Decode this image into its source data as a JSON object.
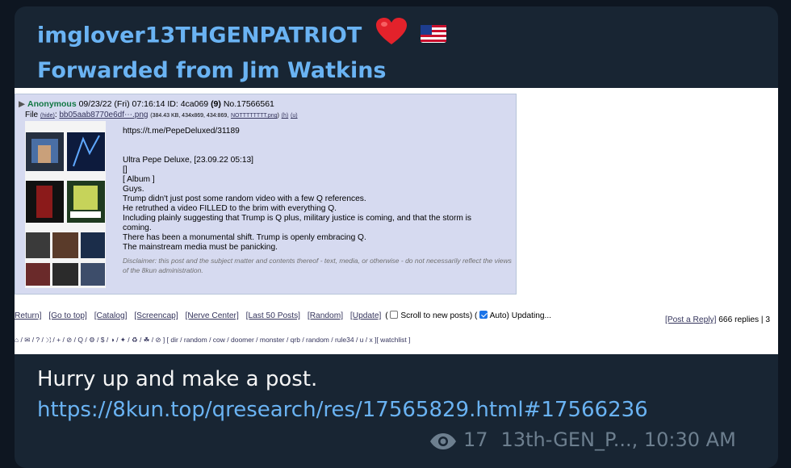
{
  "header": {
    "sender": "imglover13THGENPATRIOT",
    "forwarded": "Forwarded from Jim Watkins",
    "icons": [
      "heart-icon",
      "us-flag-icon"
    ]
  },
  "post": {
    "name": "Anonymous",
    "date": "09/23/22 (Fri) 07:16:14",
    "id_label": "ID:",
    "id": "4ca069",
    "id_count": "(9)",
    "number": "No.17566561",
    "file_label": "File",
    "hide": "(hide)",
    "filename": "bb05aab8770e6df⋯.png",
    "file_info": "(384.43 KB, 434x869, 434:869,",
    "file_orig": "NOTTTTTTTT.png",
    "file_tail": ")",
    "file_h": "(h)",
    "file_u": "(u)",
    "body": [
      "https://t.me/PepeDeluxed/31189",
      "",
      "",
      "Ultra Pepe Deluxe, [23.09.22 05:13]",
      "[]",
      "[ Album ]",
      "Guys.",
      "Trump didn't just post some random video with a few Q references.",
      "He retruthed a video FILLED to the brim with everything Q.",
      "Including plainly suggesting that Trump is Q plus, military justice is coming, and that the storm is",
      "coming.",
      "There has been a monumental shift. Trump is openly embracing Q.",
      "The mainstream media must be panicking."
    ],
    "disclaimer": "Disclaimer: this post and the subject matter and contents thereof - text, media, or otherwise - do not necessarily reflect the views of the 8kun administration."
  },
  "nav": {
    "links": [
      "Return]",
      "[Go to top]",
      "[Catalog]",
      "[Screencap]",
      "[Nerve Center]",
      "[Last 50 Posts]",
      "[Random]",
      "[Update]"
    ],
    "scroll_open": "(",
    "scroll_label": "Scroll to new posts) (",
    "scroll_checked": false,
    "auto_label": "Auto) Updating...",
    "auto_checked": true,
    "post_reply": "[Post a Reply]",
    "replies": "666 replies | 3"
  },
  "boards_line": "⌂ / ✉ / ? / ⤨ / + / ⊘ / Q / ⚙ / $ / ◑ / ✦ / ♻ / ☘ / ⊘ ] [ dir / random / cow / doomer / monster / qrb / random / rule34 / u / x ][ watchlist ]",
  "message": {
    "text": "Hurry up and make a post.",
    "link": "https://8kun.top/qresearch/res/17565829.html#17566236"
  },
  "footer": {
    "views": "17",
    "author": "13th-GEN_P...,",
    "time": "10:30 AM"
  },
  "colors": {
    "background": "#0e1621",
    "bubble": "#182533",
    "accent": "#6ab3f3",
    "post_bg": "#d6daf0",
    "anon_name": "#117743",
    "meta_text": "#6d7f8f"
  }
}
